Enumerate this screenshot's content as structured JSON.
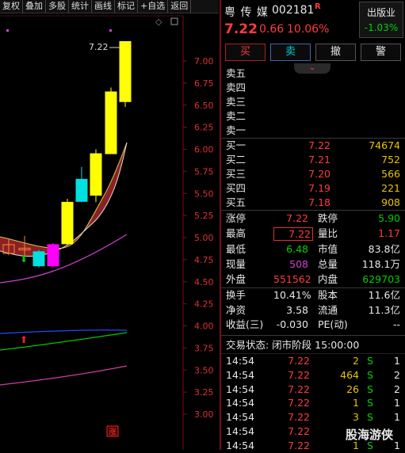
{
  "toolbar": [
    "复权",
    "叠加",
    "多股",
    "统计",
    "画线",
    "标记",
    "+自选",
    "返回"
  ],
  "chart": {
    "price_ticks": [
      "7.00",
      "6.75",
      "6.50",
      "6.25",
      "6.00",
      "5.75",
      "5.50",
      "5.25",
      "5.00",
      "4.75",
      "4.50",
      "4.25",
      "4.00",
      "3.75",
      "3.50",
      "3.25",
      "3.00"
    ],
    "high_annotation": "7.22",
    "bottom_badge": "涨"
  },
  "header": {
    "name": "粤 传 媒",
    "code": "002181",
    "flag": "R",
    "price": "7.22",
    "change": "0.66",
    "change_pct": "10.06%",
    "industry": "出版业",
    "industry_pct": "-1.03%"
  },
  "actions": {
    "buy": "买",
    "sell": "卖",
    "cancel": "撤",
    "alert": "警"
  },
  "asks": [
    {
      "label": "卖五",
      "price": "",
      "vol": ""
    },
    {
      "label": "卖四",
      "price": "",
      "vol": ""
    },
    {
      "label": "卖三",
      "price": "",
      "vol": ""
    },
    {
      "label": "卖二",
      "price": "",
      "vol": ""
    },
    {
      "label": "卖一",
      "price": "",
      "vol": ""
    }
  ],
  "bids": [
    {
      "label": "买一",
      "price": "7.22",
      "vol": "74674"
    },
    {
      "label": "买二",
      "price": "7.21",
      "vol": "752"
    },
    {
      "label": "买三",
      "price": "7.20",
      "vol": "566"
    },
    {
      "label": "买四",
      "price": "7.19",
      "vol": "221"
    },
    {
      "label": "买五",
      "price": "7.18",
      "vol": "908"
    }
  ],
  "stats1": [
    {
      "l1": "涨停",
      "v1": "7.22",
      "l2": "跌停",
      "v2": "5.90"
    },
    {
      "l1": "最高",
      "v1": "7.22",
      "l2": "量比",
      "v2": "1.17"
    },
    {
      "l1": "最低",
      "v1": "6.48",
      "l2": "市值",
      "v2": "83.8亿"
    },
    {
      "l1": "现量",
      "v1": "508",
      "l2": "总量",
      "v2": "118.1万"
    },
    {
      "l1": "外盘",
      "v1": "551562",
      "l2": "内盘",
      "v2": "629703"
    }
  ],
  "stats2": [
    {
      "l1": "换手",
      "v1": "10.41%",
      "l2": "股本",
      "v2": "11.6亿"
    },
    {
      "l1": "净资",
      "v1": "3.58",
      "l2": "流通",
      "v2": "11.3亿"
    },
    {
      "l1": "收益(三)",
      "v1": "-0.030",
      "l2": "PE(动)",
      "v2": "--"
    }
  ],
  "trade_status": "交易状态: 闭市阶段 15:00:00",
  "ticks": [
    {
      "time": "14:54",
      "price": "7.22",
      "vol": "2",
      "side": "S",
      "n": "1"
    },
    {
      "time": "14:54",
      "price": "7.22",
      "vol": "464",
      "side": "S",
      "n": "2"
    },
    {
      "time": "14:54",
      "price": "7.22",
      "vol": "26",
      "side": "S",
      "n": "2"
    },
    {
      "time": "14:54",
      "price": "7.22",
      "vol": "1",
      "side": "S",
      "n": "1"
    },
    {
      "time": "14:54",
      "price": "7.22",
      "vol": "3",
      "side": "S",
      "n": "1"
    },
    {
      "time": "14:54",
      "price": "7.22",
      "vol": "",
      "side": "",
      "n": ""
    },
    {
      "time": "14:54",
      "price": "7.22",
      "vol": "1",
      "side": "S",
      "n": "1"
    }
  ],
  "watermark": "股海游侠",
  "colors": {
    "up": "#ff3b3b",
    "down": "#00d000",
    "accent": "#e8c400"
  }
}
